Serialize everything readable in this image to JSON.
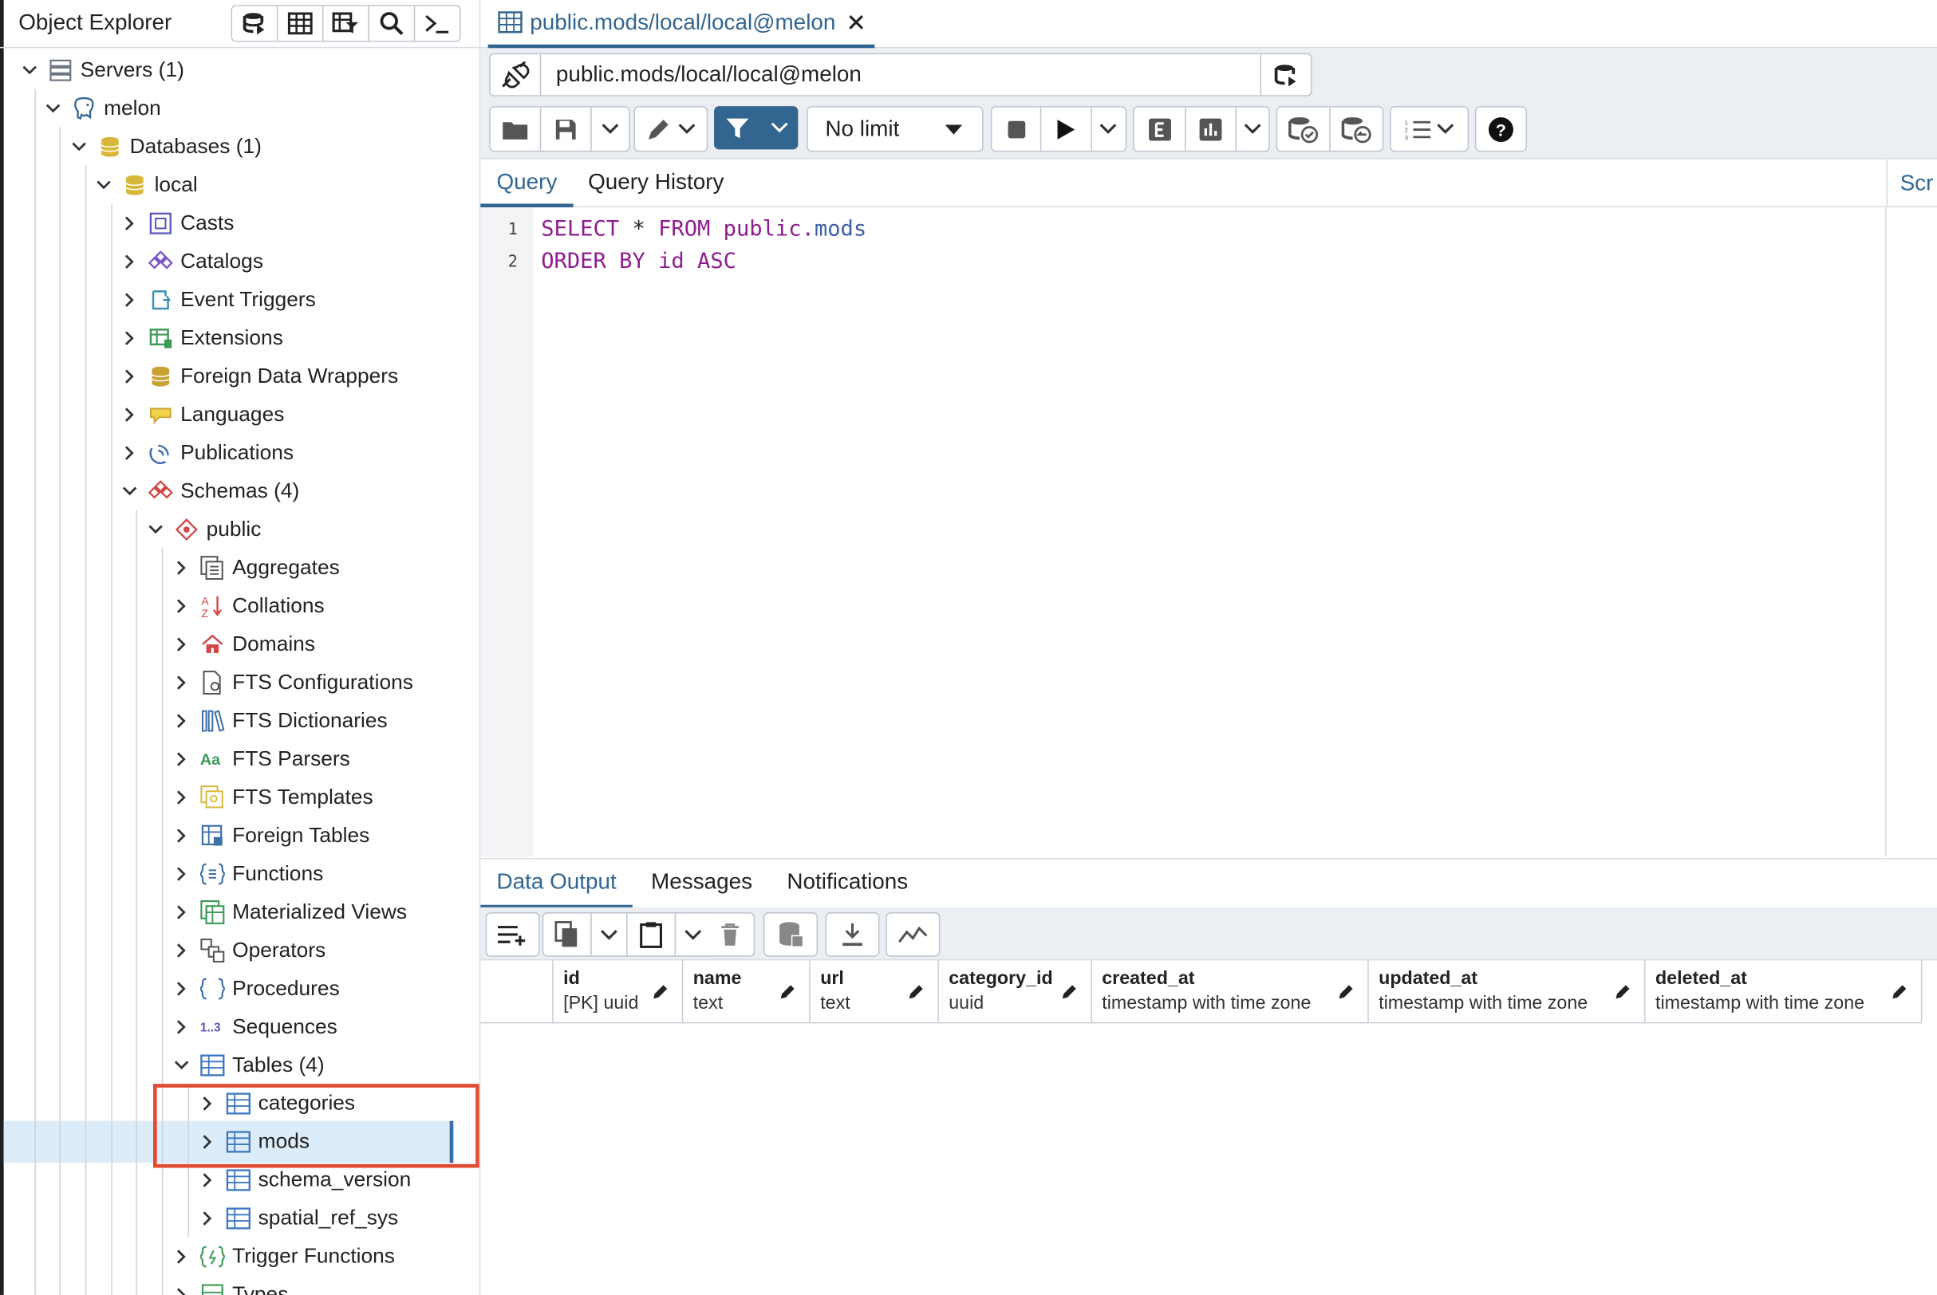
{
  "object_explorer": {
    "title": "Object Explorer",
    "toolbar": [
      "db-query-icon",
      "table-icon",
      "table-filter-icon",
      "search-icon",
      "terminal-icon"
    ]
  },
  "tree": [
    {
      "label": "Servers (1)",
      "icon": "servers-icon",
      "level": 0,
      "expanded": true
    },
    {
      "label": "melon",
      "icon": "postgres-elephant-icon",
      "level": 1,
      "expanded": true
    },
    {
      "label": "Databases (1)",
      "icon": "databases-icon",
      "level": 2,
      "expanded": true
    },
    {
      "label": "local",
      "icon": "database-icon",
      "level": 3,
      "expanded": true
    },
    {
      "label": "Casts",
      "icon": "casts-icon",
      "level": 4,
      "expanded": false
    },
    {
      "label": "Catalogs",
      "icon": "catalogs-icon",
      "level": 4,
      "expanded": false
    },
    {
      "label": "Event Triggers",
      "icon": "event-triggers-icon",
      "level": 4,
      "expanded": false
    },
    {
      "label": "Extensions",
      "icon": "extensions-icon",
      "level": 4,
      "expanded": false
    },
    {
      "label": "Foreign Data Wrappers",
      "icon": "foreign-data-wrappers-icon",
      "level": 4,
      "expanded": false
    },
    {
      "label": "Languages",
      "icon": "languages-icon",
      "level": 4,
      "expanded": false
    },
    {
      "label": "Publications",
      "icon": "publications-icon",
      "level": 4,
      "expanded": false
    },
    {
      "label": "Schemas (4)",
      "icon": "schemas-icon",
      "level": 4,
      "expanded": true
    },
    {
      "label": "public",
      "icon": "schema-icon",
      "level": 5,
      "expanded": true
    },
    {
      "label": "Aggregates",
      "icon": "aggregates-icon",
      "level": 6,
      "expanded": false
    },
    {
      "label": "Collations",
      "icon": "collations-icon",
      "level": 6,
      "expanded": false
    },
    {
      "label": "Domains",
      "icon": "domains-icon",
      "level": 6,
      "expanded": false
    },
    {
      "label": "FTS Configurations",
      "icon": "fts-configurations-icon",
      "level": 6,
      "expanded": false
    },
    {
      "label": "FTS Dictionaries",
      "icon": "fts-dictionaries-icon",
      "level": 6,
      "expanded": false
    },
    {
      "label": "FTS Parsers",
      "icon": "fts-parsers-icon",
      "level": 6,
      "expanded": false
    },
    {
      "label": "FTS Templates",
      "icon": "fts-templates-icon",
      "level": 6,
      "expanded": false
    },
    {
      "label": "Foreign Tables",
      "icon": "foreign-tables-icon",
      "level": 6,
      "expanded": false
    },
    {
      "label": "Functions",
      "icon": "functions-icon",
      "level": 6,
      "expanded": false
    },
    {
      "label": "Materialized Views",
      "icon": "materialized-views-icon",
      "level": 6,
      "expanded": false
    },
    {
      "label": "Operators",
      "icon": "operators-icon",
      "level": 6,
      "expanded": false
    },
    {
      "label": "Procedures",
      "icon": "procedures-icon",
      "level": 6,
      "expanded": false
    },
    {
      "label": "Sequences",
      "icon": "sequences-icon",
      "level": 6,
      "expanded": false
    },
    {
      "label": "Tables (4)",
      "icon": "tables-icon",
      "level": 6,
      "expanded": true
    },
    {
      "label": "categories",
      "icon": "table-icon",
      "level": 7,
      "expanded": false
    },
    {
      "label": "mods",
      "icon": "table-icon",
      "level": 7,
      "expanded": false,
      "selected": true
    },
    {
      "label": "schema_version",
      "icon": "table-icon",
      "level": 7,
      "expanded": false
    },
    {
      "label": "spatial_ref_sys",
      "icon": "table-icon",
      "level": 7,
      "expanded": false
    },
    {
      "label": "Trigger Functions",
      "icon": "trigger-functions-icon",
      "level": 6,
      "expanded": false
    },
    {
      "label": "Types",
      "icon": "types-icon",
      "level": 6,
      "expanded": false
    }
  ],
  "editor_tab": {
    "title": "public.mods/local/local@melon"
  },
  "connection": {
    "label": "public.mods/local/local@melon"
  },
  "limit": {
    "value": "No limit"
  },
  "query_tabs": [
    "Query",
    "Query History"
  ],
  "scratch_tab": "Scr",
  "code": {
    "line_numbers": [
      "1",
      "2"
    ],
    "line1": {
      "select": "SELECT",
      "star": " * ",
      "from": "FROM",
      "schema": " public.",
      "table": "mods"
    },
    "line2": {
      "order_by": "ORDER BY",
      "col": " id ",
      "asc": "ASC"
    }
  },
  "output_tabs": [
    "Data Output",
    "Messages",
    "Notifications"
  ],
  "columns": [
    {
      "name": "id",
      "type": "[PK] uuid"
    },
    {
      "name": "name",
      "type": "text"
    },
    {
      "name": "url",
      "type": "text"
    },
    {
      "name": "category_id",
      "type": "uuid"
    },
    {
      "name": "created_at",
      "type": "timestamp with time zone"
    },
    {
      "name": "updated_at",
      "type": "timestamp with time zone"
    },
    {
      "name": "deleted_at",
      "type": "timestamp with time zone"
    }
  ],
  "colors": {
    "accent": "#326690",
    "keyword": "#8f1d8f",
    "identifier": "#3a5fa8",
    "highlight_box": "#e34a33",
    "selection": "#dcecf8"
  }
}
